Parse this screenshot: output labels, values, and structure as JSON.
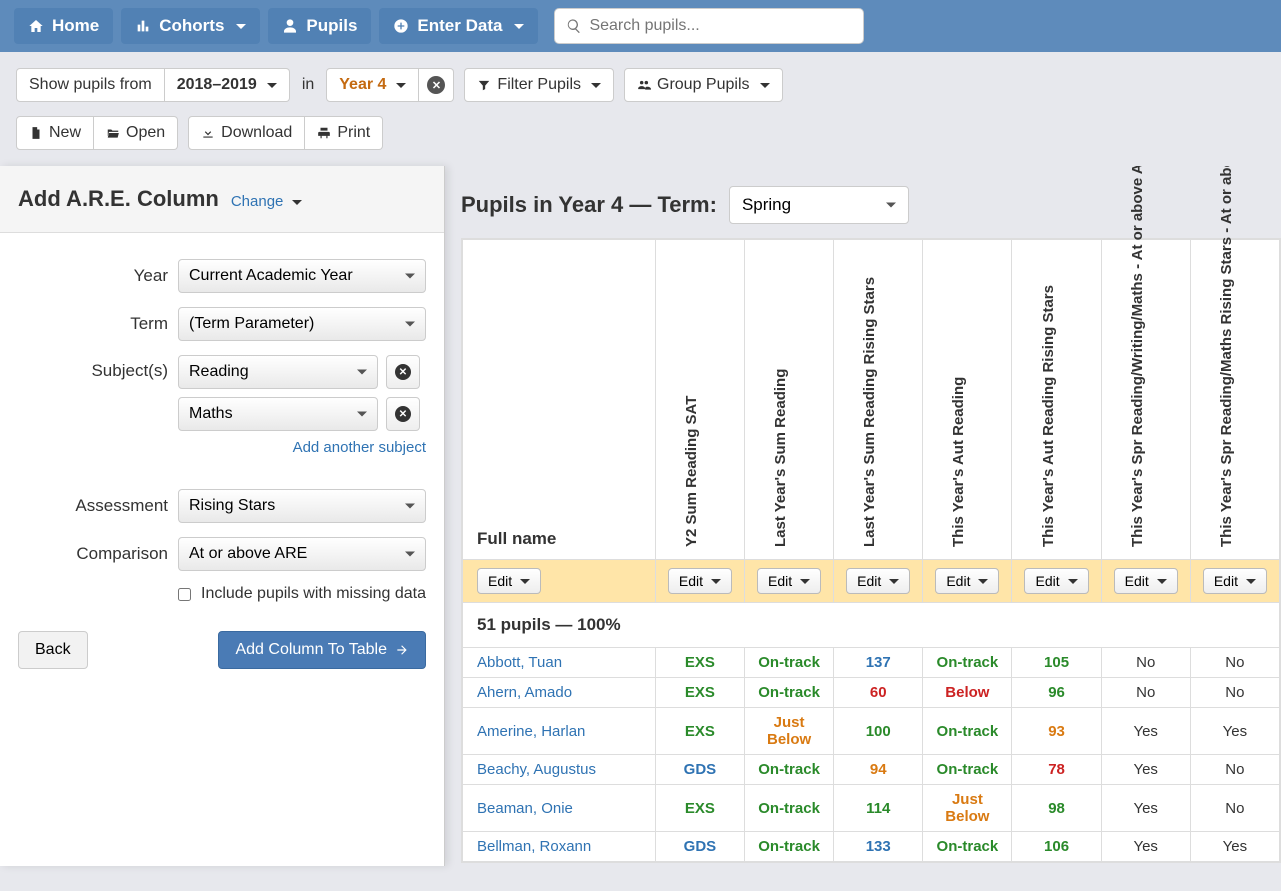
{
  "nav": {
    "home": "Home",
    "cohorts": "Cohorts",
    "pupils": "Pupils",
    "enter_data": "Enter Data",
    "search_placeholder": "Search pupils..."
  },
  "filters": {
    "show_from_label": "Show pupils from",
    "year_range": "2018–2019",
    "in_label": "in",
    "year_group": "Year 4",
    "filter_pupils": "Filter Pupils",
    "group_pupils": "Group Pupils"
  },
  "actions": {
    "new": "New",
    "open": "Open",
    "download": "Download",
    "print": "Print"
  },
  "panel": {
    "title": "Add A.R.E. Column",
    "change": "Change",
    "labels": {
      "year": "Year",
      "term": "Term",
      "subjects": "Subject(s)",
      "assessment": "Assessment",
      "comparison": "Comparison"
    },
    "values": {
      "year": "Current Academic Year",
      "term": "(Term Parameter)",
      "subjects": [
        "Reading",
        "Maths"
      ],
      "assessment": "Rising Stars",
      "comparison": "At or above ARE"
    },
    "add_another": "Add another subject",
    "include_missing": "Include pupils with missing data",
    "back": "Back",
    "add_column": "Add Column To Table"
  },
  "right": {
    "header_prefix": "Pupils in Year 4 — Term:",
    "term": "Spring",
    "columns": {
      "name": "Full name",
      "c1": "Y2 Sum Reading SAT",
      "c2": "Last Year's Sum Reading",
      "c3": "Last Year's Sum Reading Rising Stars",
      "c4": "This Year's Aut Reading",
      "c5": "This Year's Aut Reading Rising Stars",
      "c6": "This Year's Spr Reading/Writing/Maths - At or above ARE",
      "c7": "This Year's Spr Reading/Maths Rising Stars - At or above ARE"
    },
    "edit_label": "Edit",
    "summary": "51 pupils — 100%",
    "rows": [
      {
        "name": "Abbott, Tuan",
        "cells": [
          {
            "v": "EXS",
            "c": "green"
          },
          {
            "v": "On-track",
            "c": "green"
          },
          {
            "v": "137",
            "c": "blue"
          },
          {
            "v": "On-track",
            "c": "green"
          },
          {
            "v": "105",
            "c": "green"
          },
          {
            "v": "No"
          },
          {
            "v": "No"
          }
        ]
      },
      {
        "name": "Ahern, Amado",
        "cells": [
          {
            "v": "EXS",
            "c": "green"
          },
          {
            "v": "On-track",
            "c": "green"
          },
          {
            "v": "60",
            "c": "red"
          },
          {
            "v": "Below",
            "c": "red"
          },
          {
            "v": "96",
            "c": "green"
          },
          {
            "v": "No"
          },
          {
            "v": "No"
          }
        ]
      },
      {
        "name": "Amerine, Harlan",
        "cells": [
          {
            "v": "EXS",
            "c": "green"
          },
          {
            "v": "Just Below",
            "c": "orange"
          },
          {
            "v": "100",
            "c": "green"
          },
          {
            "v": "On-track",
            "c": "green"
          },
          {
            "v": "93",
            "c": "orange"
          },
          {
            "v": "Yes"
          },
          {
            "v": "Yes"
          }
        ]
      },
      {
        "name": "Beachy, Augustus",
        "cells": [
          {
            "v": "GDS",
            "c": "blue"
          },
          {
            "v": "On-track",
            "c": "green"
          },
          {
            "v": "94",
            "c": "orange"
          },
          {
            "v": "On-track",
            "c": "green"
          },
          {
            "v": "78",
            "c": "red"
          },
          {
            "v": "Yes"
          },
          {
            "v": "No"
          }
        ]
      },
      {
        "name": "Beaman, Onie",
        "cells": [
          {
            "v": "EXS",
            "c": "green"
          },
          {
            "v": "On-track",
            "c": "green"
          },
          {
            "v": "114",
            "c": "green"
          },
          {
            "v": "Just Below",
            "c": "orange"
          },
          {
            "v": "98",
            "c": "green"
          },
          {
            "v": "Yes"
          },
          {
            "v": "No"
          }
        ]
      },
      {
        "name": "Bellman, Roxann",
        "cells": [
          {
            "v": "GDS",
            "c": "blue"
          },
          {
            "v": "On-track",
            "c": "green"
          },
          {
            "v": "133",
            "c": "blue"
          },
          {
            "v": "On-track",
            "c": "green"
          },
          {
            "v": "106",
            "c": "green"
          },
          {
            "v": "Yes"
          },
          {
            "v": "Yes"
          }
        ]
      }
    ]
  }
}
